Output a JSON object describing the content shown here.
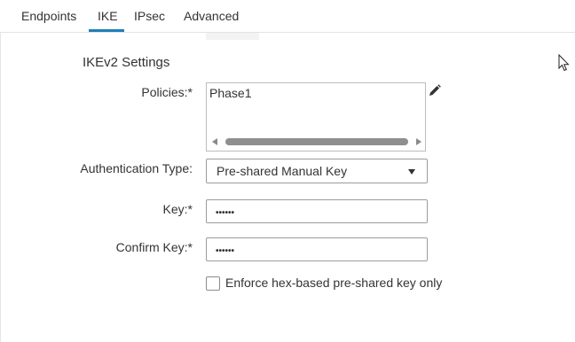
{
  "tabs": [
    {
      "label": "Endpoints",
      "active": false
    },
    {
      "label": "IKE",
      "active": true
    },
    {
      "label": "IPsec",
      "active": false
    },
    {
      "label": "Advanced",
      "active": false
    }
  ],
  "accent_color": "#1f7fb7",
  "section": {
    "title": "IKEv2 Settings"
  },
  "policies": {
    "label": "Policies:*",
    "items": [
      "Phase1"
    ],
    "edit_icon": "pencil-icon"
  },
  "auth_type": {
    "label": "Authentication Type:",
    "value": "Pre-shared Manual Key"
  },
  "key": {
    "label": "Key:*",
    "value": "••••••"
  },
  "confirm_key": {
    "label": "Confirm Key:*",
    "value": "••••••"
  },
  "enforce_hex": {
    "label": "Enforce hex-based pre-shared key only",
    "checked": false
  }
}
